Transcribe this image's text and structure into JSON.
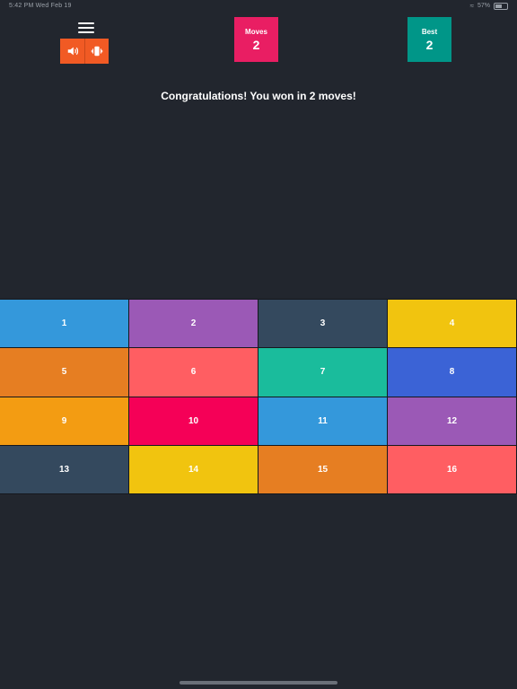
{
  "status_bar": {
    "time": "5:42 PM  Wed Feb 19",
    "battery": "57%"
  },
  "icons": {
    "menu": "hamburger-icon",
    "sound": "speaker-icon",
    "vibration": "vibrate-icon"
  },
  "scores": {
    "moves": {
      "label": "Moves",
      "value": "2",
      "color": "#e91e63"
    },
    "best": {
      "label": "Best",
      "value": "2",
      "color": "#009688"
    }
  },
  "message": "Congratulations! You won in 2 moves!",
  "tiles": [
    {
      "label": "1",
      "color": "#3498db"
    },
    {
      "label": "2",
      "color": "#9b59b6"
    },
    {
      "label": "3",
      "color": "#34495e"
    },
    {
      "label": "4",
      "color": "#f1c40f"
    },
    {
      "label": "5",
      "color": "#e67e22"
    },
    {
      "label": "6",
      "color": "#ff5e62"
    },
    {
      "label": "7",
      "color": "#1abc9c"
    },
    {
      "label": "8",
      "color": "#3b63d6"
    },
    {
      "label": "9",
      "color": "#f39c12"
    },
    {
      "label": "10",
      "color": "#f50057"
    },
    {
      "label": "11",
      "color": "#3498db"
    },
    {
      "label": "12",
      "color": "#9b59b6"
    },
    {
      "label": "13",
      "color": "#34495e"
    },
    {
      "label": "14",
      "color": "#f1c40f"
    },
    {
      "label": "15",
      "color": "#e67e22"
    },
    {
      "label": "16",
      "color": "#ff5e62"
    }
  ]
}
